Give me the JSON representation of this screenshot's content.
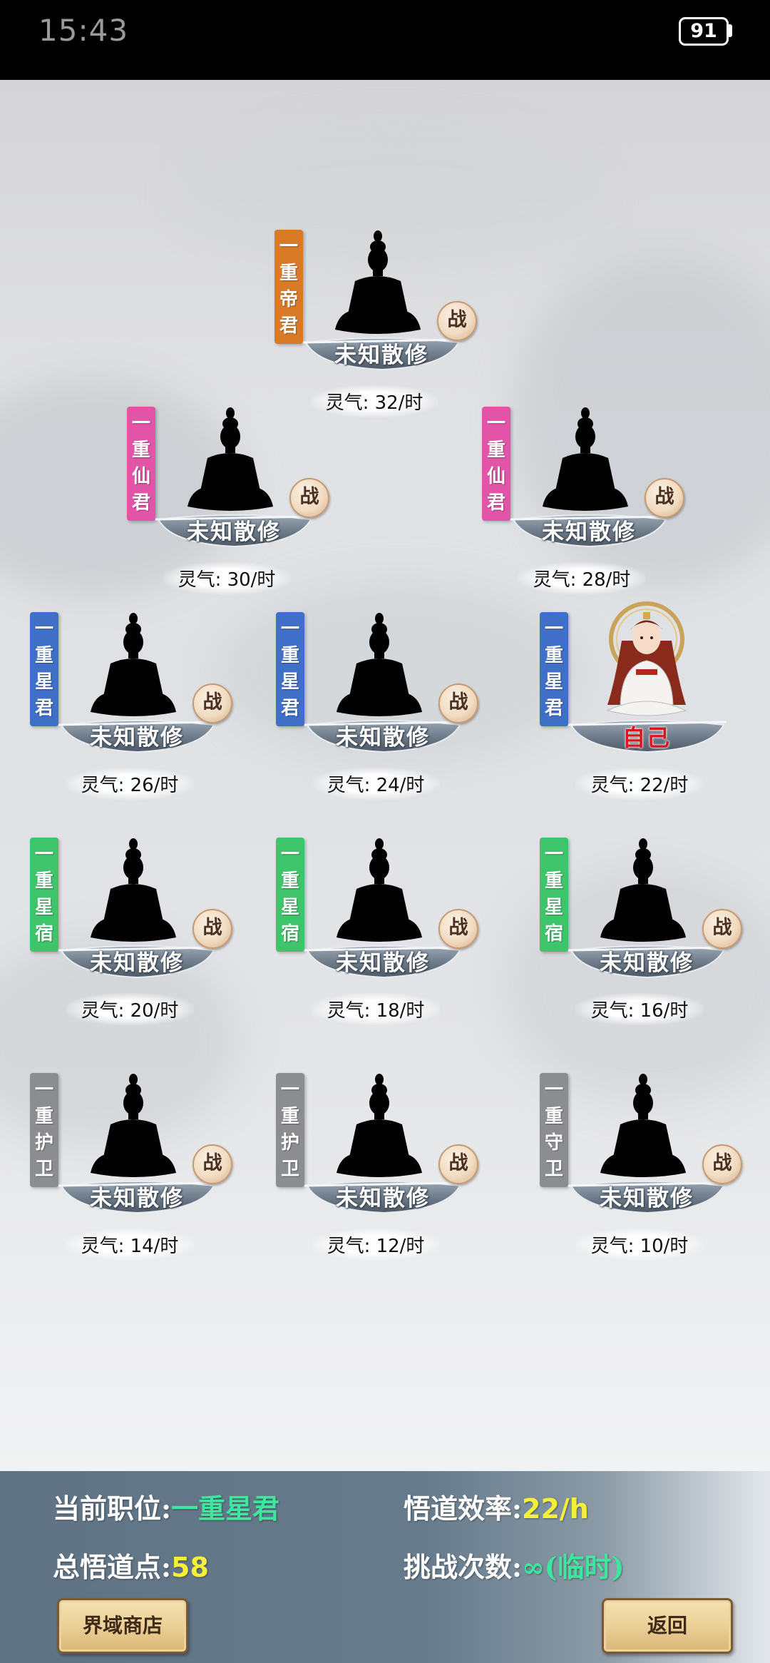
{
  "status_bar": {
    "time": "15:43",
    "battery": "91"
  },
  "colors": {
    "emperor": "#d97a27",
    "immortal": "#e254a8",
    "star_lord": "#3f6fc7",
    "constellation": "#3ec46a",
    "guard": "#8c8d90",
    "current_rank_text": "#3fe6a0",
    "number_text": "#f4f03a"
  },
  "ranks": [
    {
      "rank": "一重帝君",
      "rank_chars": [
        "一",
        "重",
        "帝",
        "君"
      ],
      "color": "emperor",
      "name": "未知散修",
      "rate": "灵气: 32/时",
      "fight": "战"
    },
    {
      "rank": "一重仙君",
      "rank_chars": [
        "一",
        "重",
        "仙",
        "君"
      ],
      "color": "immortal",
      "name": "未知散修",
      "rate": "灵气: 30/时",
      "fight": "战"
    },
    {
      "rank": "一重仙君",
      "rank_chars": [
        "一",
        "重",
        "仙",
        "君"
      ],
      "color": "immortal",
      "name": "未知散修",
      "rate": "灵气: 28/时",
      "fight": "战"
    },
    {
      "rank": "一重星君",
      "rank_chars": [
        "一",
        "重",
        "星",
        "君"
      ],
      "color": "star_lord",
      "name": "未知散修",
      "rate": "灵气: 26/时",
      "fight": "战"
    },
    {
      "rank": "一重星君",
      "rank_chars": [
        "一",
        "重",
        "星",
        "君"
      ],
      "color": "star_lord",
      "name": "未知散修",
      "rate": "灵气: 24/时",
      "fight": "战"
    },
    {
      "rank": "一重星君",
      "rank_chars": [
        "一",
        "重",
        "星",
        "君"
      ],
      "color": "star_lord",
      "name": "自己",
      "rate": "灵气: 22/时",
      "is_self": true
    },
    {
      "rank": "一重星宿",
      "rank_chars": [
        "一",
        "重",
        "星",
        "宿"
      ],
      "color": "constellation",
      "name": "未知散修",
      "rate": "灵气: 20/时",
      "fight": "战"
    },
    {
      "rank": "一重星宿",
      "rank_chars": [
        "一",
        "重",
        "星",
        "宿"
      ],
      "color": "constellation",
      "name": "未知散修",
      "rate": "灵气: 18/时",
      "fight": "战"
    },
    {
      "rank": "一重星宿",
      "rank_chars": [
        "一",
        "重",
        "星",
        "宿"
      ],
      "color": "constellation",
      "name": "未知散修",
      "rate": "灵气: 16/时",
      "fight": "战"
    },
    {
      "rank": "一重护卫",
      "rank_chars": [
        "一",
        "重",
        "护",
        "卫"
      ],
      "color": "guard",
      "name": "未知散修",
      "rate": "灵气: 14/时",
      "fight": "战"
    },
    {
      "rank": "一重护卫",
      "rank_chars": [
        "一",
        "重",
        "护",
        "卫"
      ],
      "color": "guard",
      "name": "未知散修",
      "rate": "灵气: 12/时",
      "fight": "战"
    },
    {
      "rank": "一重守卫",
      "rank_chars": [
        "一",
        "重",
        "守",
        "卫"
      ],
      "color": "guard",
      "name": "未知散修",
      "rate": "灵气: 10/时",
      "fight": "战"
    }
  ],
  "panel": {
    "current_position_label": "当前职位:",
    "current_position_value": "一重星君",
    "efficiency_label": "悟道效率:",
    "efficiency_value": "22/h",
    "total_points_label": "总悟道点:",
    "total_points_value": "58",
    "challenges_label": "挑战次数:",
    "challenges_value": "∞(临时)"
  },
  "buttons": {
    "shop": "界域商店",
    "back": "返回"
  }
}
